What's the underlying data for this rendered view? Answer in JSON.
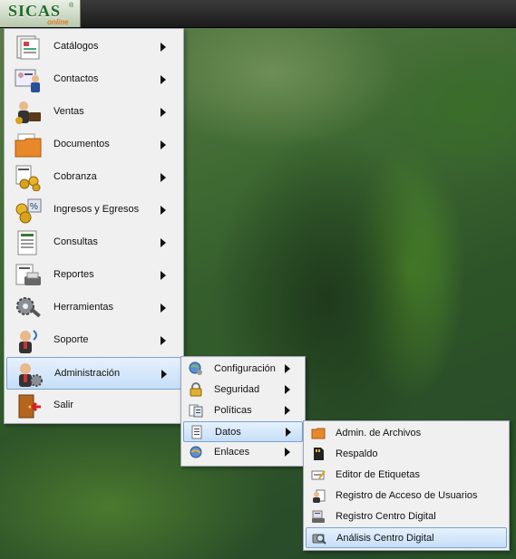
{
  "logo": {
    "text": "SICAS",
    "reg": "®",
    "sub": "online"
  },
  "main_menu": [
    {
      "label": "Catálogos",
      "icon": "catalog-icon"
    },
    {
      "label": "Contactos",
      "icon": "contacts-icon"
    },
    {
      "label": "Ventas",
      "icon": "sales-icon"
    },
    {
      "label": "Documentos",
      "icon": "documents-folder-icon"
    },
    {
      "label": "Cobranza",
      "icon": "billing-coins-icon"
    },
    {
      "label": "Ingresos y Egresos",
      "icon": "income-expense-icon"
    },
    {
      "label": "Consultas",
      "icon": "queries-icon"
    },
    {
      "label": "Reportes",
      "icon": "reports-icon"
    },
    {
      "label": "Herramientas",
      "icon": "tools-gear-icon"
    },
    {
      "label": "Soporte",
      "icon": "support-icon"
    },
    {
      "label": "Administración",
      "icon": "admin-user-gear-icon"
    },
    {
      "label": "Salir",
      "icon": "exit-door-icon"
    }
  ],
  "admin_menu": [
    {
      "label": "Configuración",
      "icon": "globe-config-icon"
    },
    {
      "label": "Seguridad",
      "icon": "lock-icon"
    },
    {
      "label": "Políticas",
      "icon": "policies-icon"
    },
    {
      "label": "Datos",
      "icon": "data-document-icon"
    },
    {
      "label": "Enlaces",
      "icon": "links-globe-icon"
    }
  ],
  "datos_menu": [
    {
      "label": "Admin. de Archivos",
      "icon": "folder-icon"
    },
    {
      "label": "Respaldo",
      "icon": "backup-card-icon"
    },
    {
      "label": "Editor de Etiquetas",
      "icon": "label-editor-icon"
    },
    {
      "label": "Registro de Acceso de Usuarios",
      "icon": "user-access-log-icon"
    },
    {
      "label": "Registro Centro Digital",
      "icon": "digital-center-register-icon"
    },
    {
      "label": "Análisis Centro Digital",
      "icon": "digital-center-analysis-icon"
    }
  ]
}
